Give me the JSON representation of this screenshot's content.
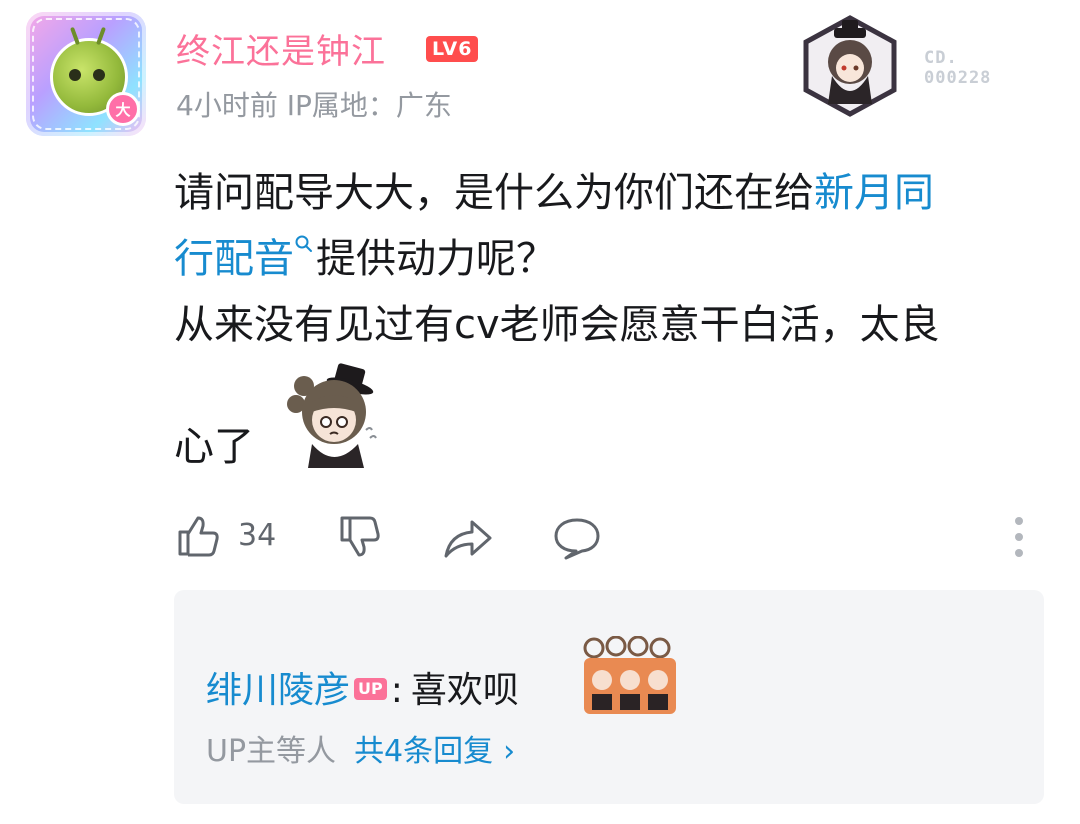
{
  "comment": {
    "user": {
      "name": "终江还是钟江",
      "level_badge": "LV6",
      "avatar_badge": "大"
    },
    "meta": "4小时前 IP属地：广东",
    "decoration": {
      "code_line1": "CD.",
      "code_line2": "000228"
    },
    "body": {
      "line1_prefix": "请问配导大大，是什么为你们还在给",
      "link_part1": "新月同",
      "link_part2": "行配音",
      "line2_suffix": "提供动力呢？",
      "line3": "从来没有见过有cv老师会愿意干白活，太良",
      "line4": "心了"
    },
    "actions": {
      "like_count": "34",
      "icons": [
        "thumbs-up-icon",
        "thumbs-down-icon",
        "share-icon",
        "comment-icon",
        "more-icon"
      ]
    },
    "replies": {
      "top_reply": {
        "user": "绯川陵彦",
        "up_badge": "UP",
        "separator": ":",
        "text": "喜欢呗"
      },
      "footer_who": "UP主等人",
      "footer_more": "共4条回复",
      "footer_chevron": "›"
    }
  },
  "colors": {
    "username": "#fb7299",
    "link": "#178bcf",
    "meta": "#9499a0",
    "level_badge": "#ff4d4d",
    "reply_panel": "#f4f5f7"
  }
}
